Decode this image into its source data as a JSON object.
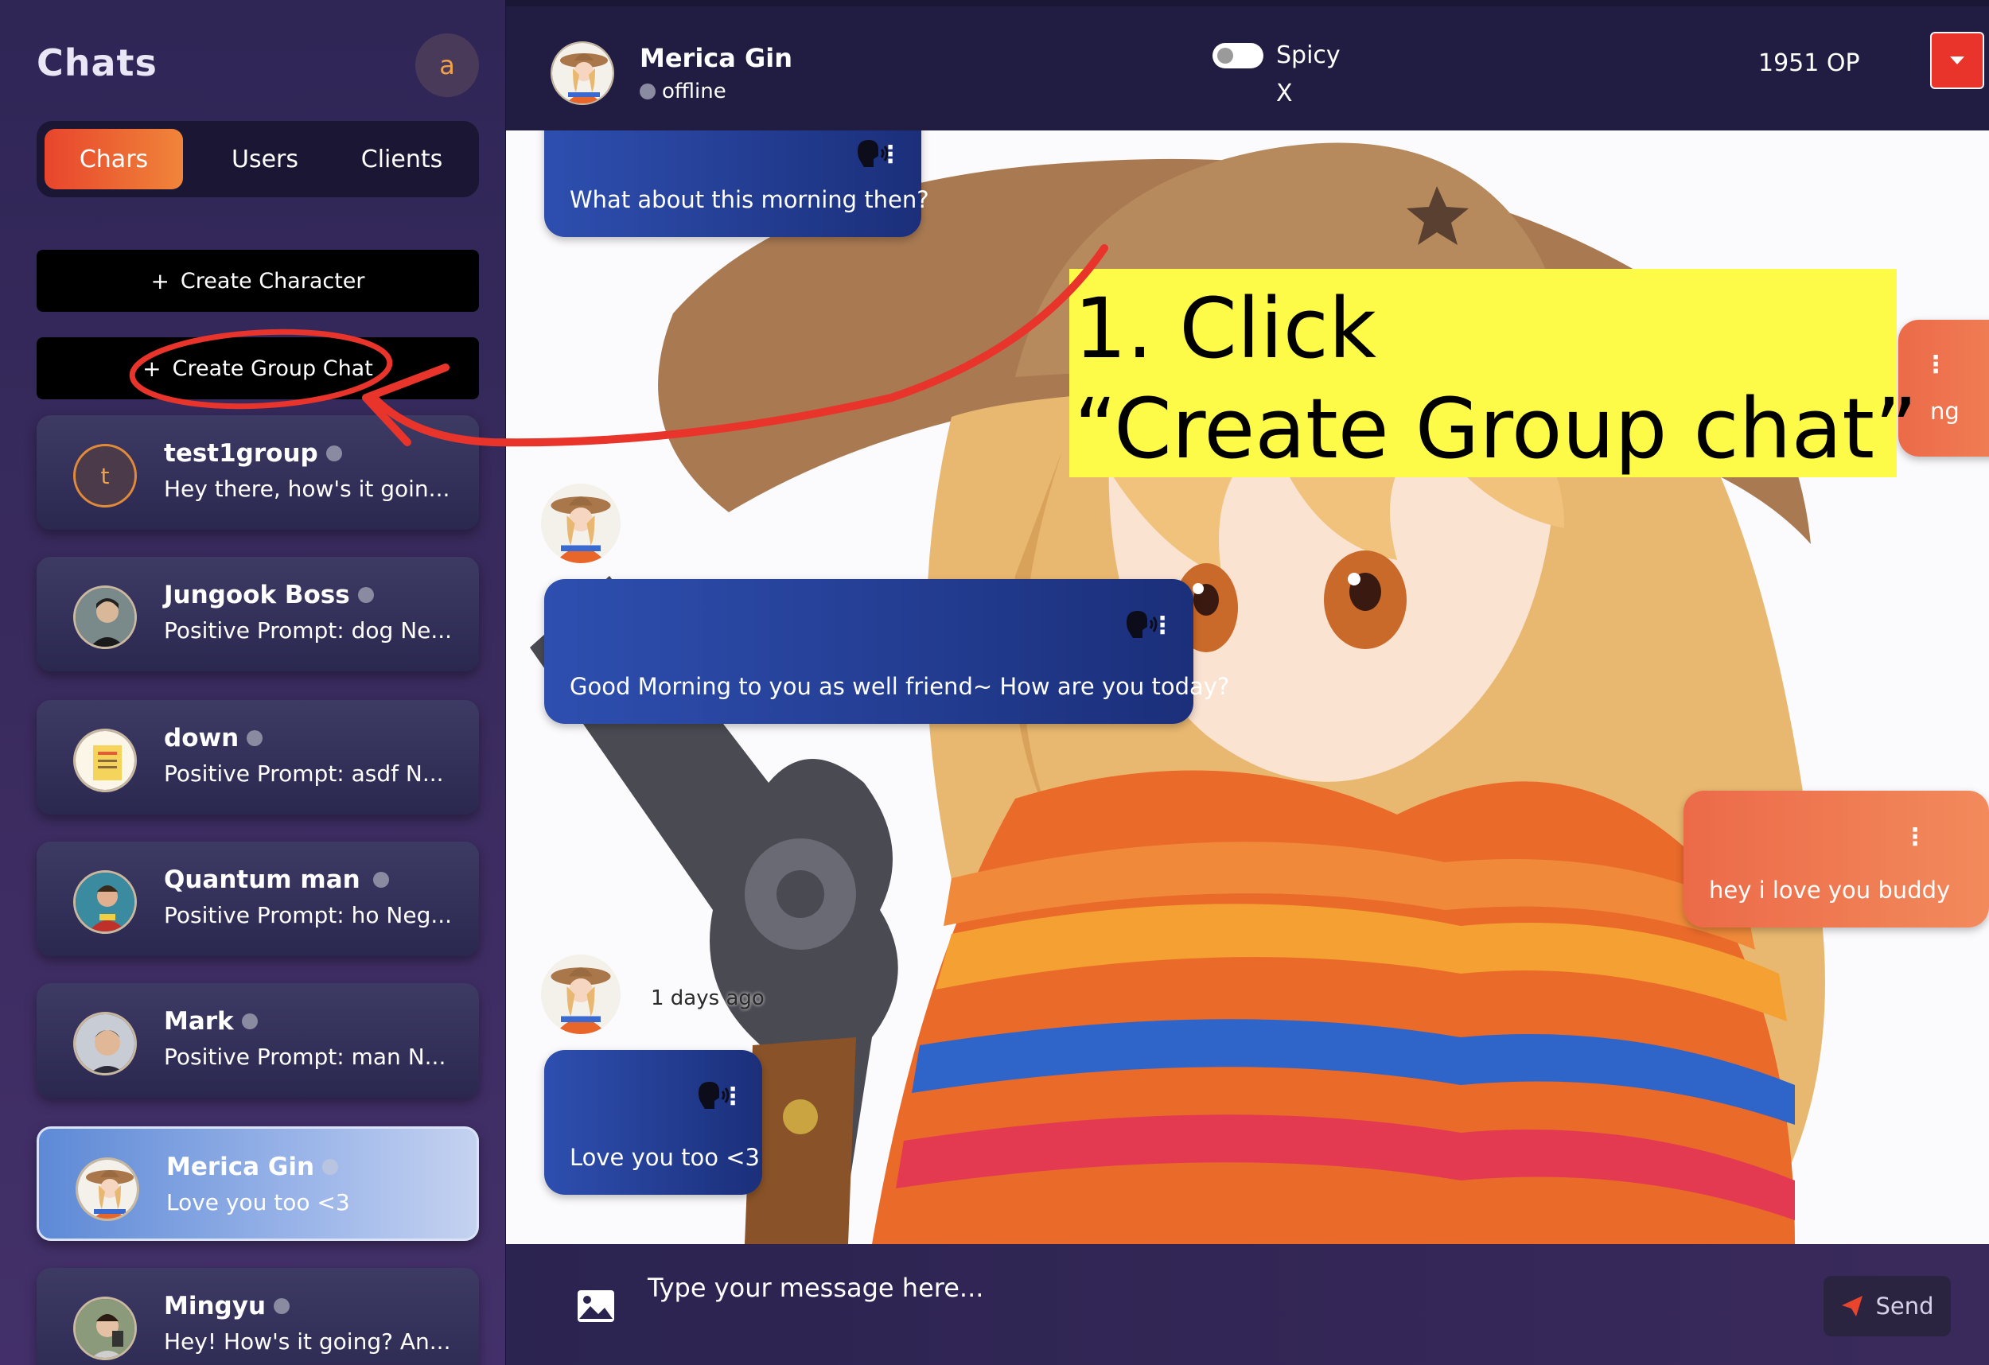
{
  "sidebar": {
    "title": "Chats",
    "user_avatar_letter": "a",
    "tabs": [
      {
        "label": "Chars",
        "active": true
      },
      {
        "label": "Users",
        "active": false
      },
      {
        "label": "Clients",
        "active": false
      }
    ],
    "create_character_label": "Create Character",
    "create_group_chat_label": "Create Group Chat",
    "chats": [
      {
        "name": "test1group",
        "preview": "Hey there, how's it goin...",
        "avatar_letter": "t",
        "online": false,
        "active": false
      },
      {
        "name": "Jungook Boss",
        "preview": "Positive Prompt: dog Ne...",
        "online": false,
        "active": false
      },
      {
        "name": "down",
        "preview": "Positive Prompt: asdf N...",
        "online": false,
        "active": false
      },
      {
        "name": "Quantum man",
        "preview": "Positive Prompt: ho Neg...",
        "online": false,
        "active": false
      },
      {
        "name": "Mark",
        "preview": "Positive Prompt: man N...",
        "online": false,
        "active": false
      },
      {
        "name": "Merica Gin",
        "preview": "Love you too <3",
        "online": false,
        "active": true
      },
      {
        "name": "Mingyu",
        "preview": "Hey! How's it going? An...",
        "online": false,
        "active": false
      }
    ]
  },
  "header": {
    "name": "Merica Gin",
    "status": "offline",
    "spicy_label": "Spicy",
    "spicy_on": false,
    "spicy_x": "X",
    "op_count": "1951 OP"
  },
  "messages": [
    {
      "role": "bot",
      "text": "What about this morning then?"
    },
    {
      "role": "user",
      "text": "ng"
    },
    {
      "role": "bot",
      "text": "Good Morning to you as well friend~ How are you today?"
    },
    {
      "role": "user",
      "text": "hey i love you buddy"
    },
    {
      "role": "bot",
      "text": "Love you too <3",
      "time": "1 days ago"
    }
  ],
  "annotation": {
    "line1": "1. Click",
    "line2": "“Create Group chat”",
    "color": "#fefa48",
    "arrow_color": "#e8342a"
  },
  "input": {
    "placeholder": "Type your message here...",
    "send_label": "Send"
  },
  "colors": {
    "accent_orange": "#e8452c",
    "bot_bubble": "#2e4fb0",
    "user_bubble": "#ec6a48",
    "menu_red": "#e8342a"
  }
}
